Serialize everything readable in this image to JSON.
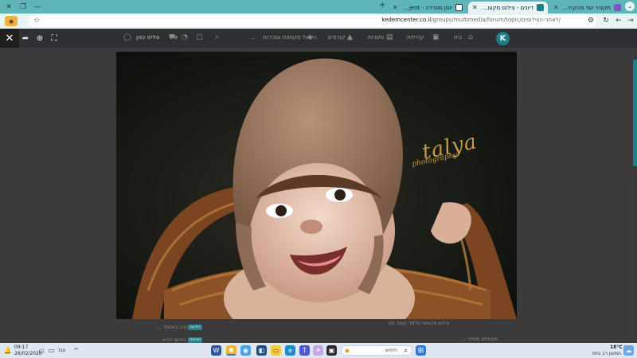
{
  "browser": {
    "tabs": [
      {
        "title": "תקציר יומי מהקהילה שלך | הכ..."
      },
      {
        "title": "דיונים - צילום מקצועי |"
      },
      {
        "title": "יומן ספרדה - Babyjent"
      }
    ],
    "url_domain": "kedemcenter.co.il",
    "url_path": "/groups/multimedia/forum/topic/לאחר-הצילומים/"
  },
  "site_header": {
    "logo_letter": "K",
    "nav": [
      {
        "label": "בית",
        "icon": "home-icon"
      },
      {
        "label": "קהילות",
        "icon": "chat-icon"
      },
      {
        "label": "משרות",
        "icon": "briefcase-icon"
      },
      {
        "label": "קורסים",
        "icon": "graduation-icon"
      },
      {
        "label": "השאל מקומות ומכירות",
        "icon": "handshake-icon"
      }
    ],
    "more": "...",
    "user_name": "טליה כהן"
  },
  "viewer": {
    "close_icon": "close-icon",
    "share_icon": "share-icon",
    "zoom_icon": "zoom-in-icon",
    "fullscreen_icon": "fullscreen-icon"
  },
  "photo": {
    "watermark_main": "talya",
    "watermark_sub": "photography"
  },
  "page_remnants": {
    "caption_left": "יהודה באחמד ...",
    "tag1": "הודעה",
    "caption_right": "צילום מקצועי מלמד קשוב עם",
    "tag2": "תגובות",
    "reply_name": "משתמש מוסיף ...",
    "follow_label": "המשך הדיון"
  },
  "taskbar": {
    "weather_temp": "18°C",
    "weather_desc": "המעון רב נחת",
    "search_placeholder": "חיפוש",
    "lang": "עבר",
    "time": "09:17",
    "date": "26/02/2026"
  },
  "colors": {
    "accent": "#17878d",
    "tabstrip": "#5fb6b8",
    "toolbar": "#e8f4f4",
    "overlay": "#3b3b3b",
    "taskbar": "#dfe7f3"
  }
}
